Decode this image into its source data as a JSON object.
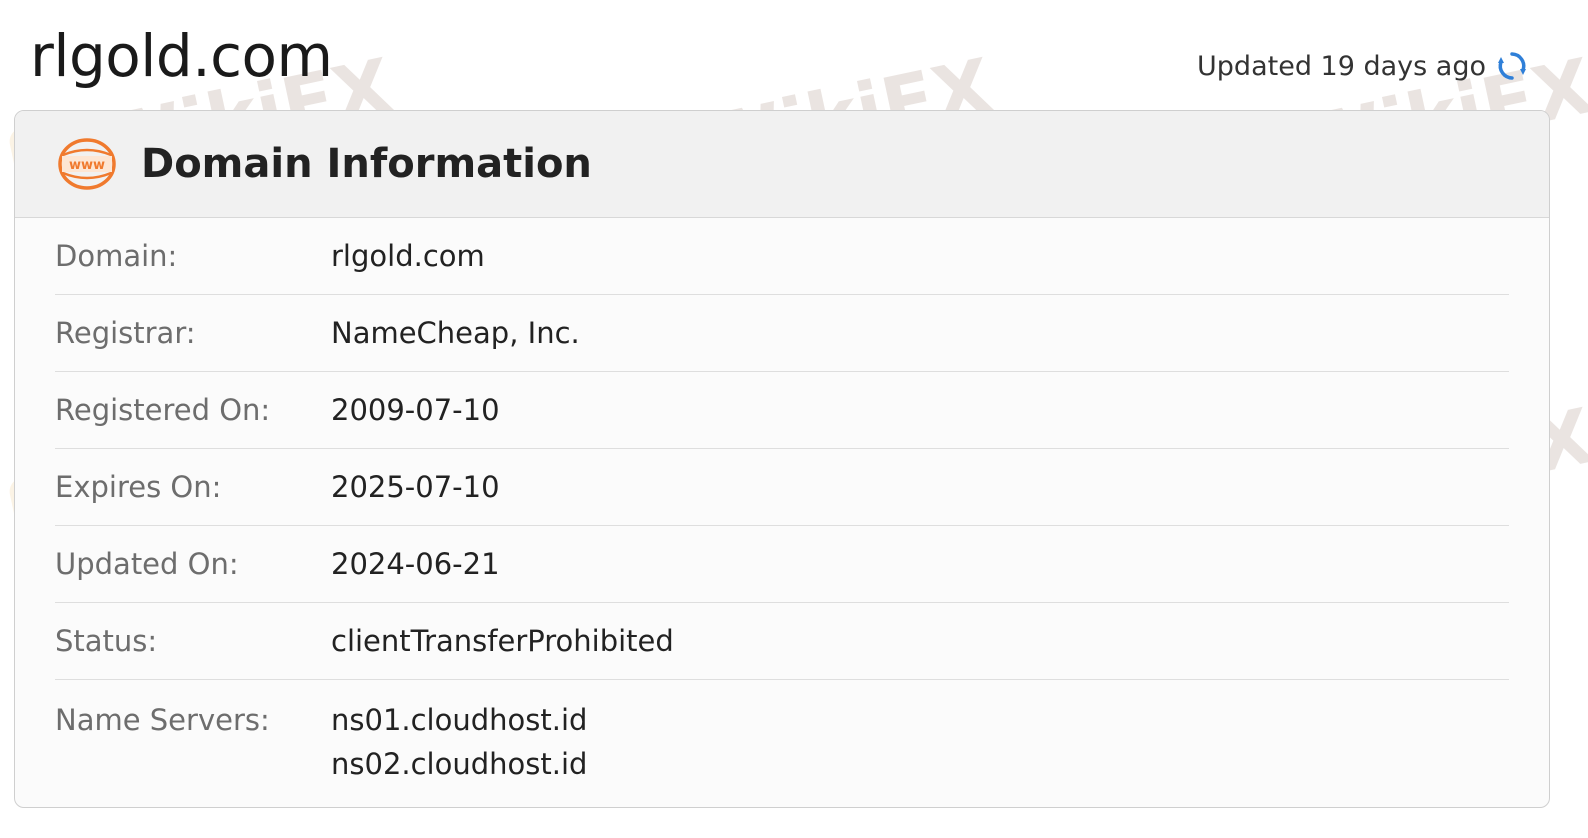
{
  "site": {
    "title": "rlgold.com",
    "updated_text": "Updated 19 days ago"
  },
  "card": {
    "title": "Domain Information",
    "icon_text": "www"
  },
  "rows": [
    {
      "label": "Domain:",
      "value": "rlgold.com"
    },
    {
      "label": "Registrar:",
      "value": "NameCheap, Inc."
    },
    {
      "label": "Registered On:",
      "value": "2009-07-10"
    },
    {
      "label": "Expires On:",
      "value": "2025-07-10"
    },
    {
      "label": "Updated On:",
      "value": "2024-06-21"
    },
    {
      "label": "Status:",
      "value": "clientTransferProhibited"
    },
    {
      "label": "Name Servers:",
      "values": [
        "ns01.cloudhost.id",
        "ns02.cloudhost.id"
      ]
    }
  ],
  "watermark": {
    "text": "WikiFX"
  },
  "colors": {
    "icon_orange": "#f07a2e",
    "refresh_blue": "#2f7fd8"
  }
}
